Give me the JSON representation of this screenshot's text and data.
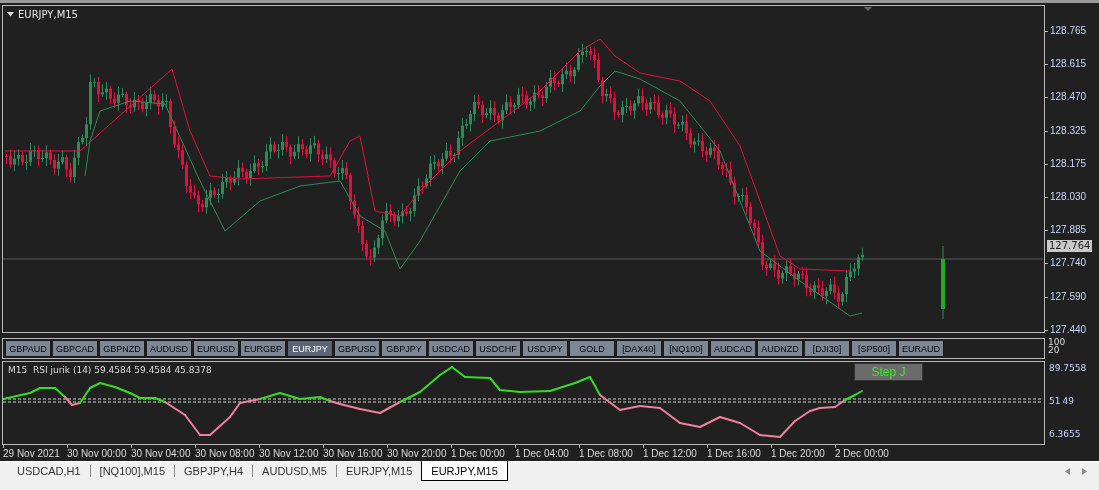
{
  "chart": {
    "symbol_title": "EURJPY,M15",
    "price_ticks": [
      "128.765",
      "128.615",
      "128.470",
      "128.325",
      "128.175",
      "128.030",
      "127.885",
      "127.740",
      "127.590",
      "127.440"
    ],
    "current_price": "127.764"
  },
  "symbol_buttons": [
    {
      "label": "GBPAUD",
      "selected": false
    },
    {
      "label": "GBPCAD",
      "selected": false
    },
    {
      "label": "GBPNZD",
      "selected": false
    },
    {
      "label": "AUDUSD",
      "selected": false
    },
    {
      "label": "EURUSD",
      "selected": false
    },
    {
      "label": "EURGBP",
      "selected": false
    },
    {
      "label": "EURJPY",
      "selected": true
    },
    {
      "label": "GBPUSD",
      "selected": false
    },
    {
      "label": "GBPJPY",
      "selected": false
    },
    {
      "label": "USDCAD",
      "selected": false
    },
    {
      "label": "USDCHF",
      "selected": false
    },
    {
      "label": "USDJPY",
      "selected": false
    },
    {
      "label": "GOLD",
      "selected": false
    },
    {
      "label": "[DAX40]",
      "selected": false
    },
    {
      "label": "[NQ100]",
      "selected": false
    },
    {
      "label": "AUDCAD",
      "selected": false
    },
    {
      "label": "AUDNZD",
      "selected": false
    },
    {
      "label": "[DJI30]",
      "selected": false
    },
    {
      "label": "[SP500]",
      "selected": false
    },
    {
      "label": "EURAUD",
      "selected": false
    }
  ],
  "button_panel_scale": [
    "100",
    "20"
  ],
  "indicator": {
    "title": "M15  RSI jurik (14) 59.4584 59.4584 45.8378",
    "button": "Step J",
    "scale_ticks": [
      "89.7558",
      "6.3655"
    ],
    "level_labels": [
      "51",
      "49"
    ]
  },
  "time_axis": [
    "29 Nov 2021",
    "30 Nov 00:00",
    "30 Nov 04:00",
    "30 Nov 08:00",
    "30 Nov 12:00",
    "30 Nov 16:00",
    "30 Nov 20:00",
    "1 Dec 00:00",
    "1 Dec 04:00",
    "1 Dec 08:00",
    "1 Dec 12:00",
    "1 Dec 16:00",
    "1 Dec 20:00",
    "2 Dec 00:00"
  ],
  "tabs": [
    {
      "label": "USDCAD,H1",
      "selected": false
    },
    {
      "label": "[NQ100],M15",
      "selected": false
    },
    {
      "label": "GBPJPY,H4",
      "selected": false
    },
    {
      "label": "AUDUSD,M5",
      "selected": false
    },
    {
      "label": "EURJPY,M15",
      "selected": false
    },
    {
      "label": "EURJPY,M15",
      "selected": true
    }
  ]
}
